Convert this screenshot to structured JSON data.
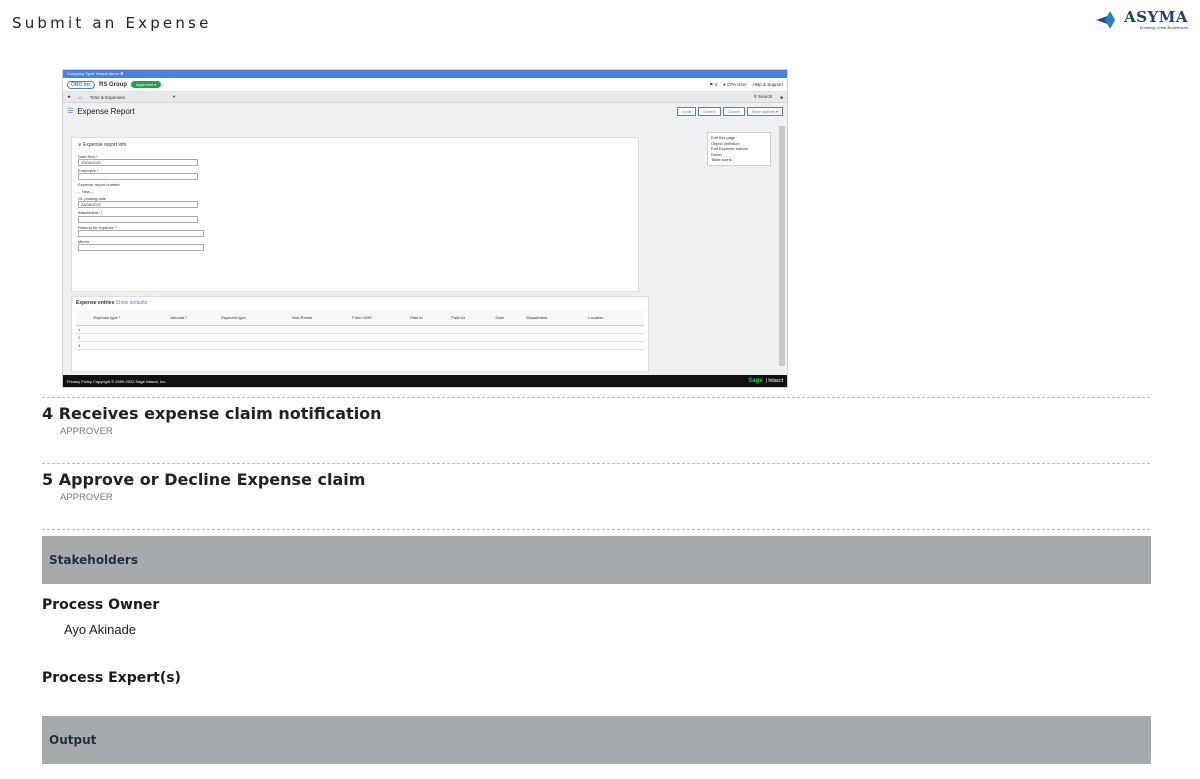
{
  "page": {
    "title": "Submit an Expense"
  },
  "logo": {
    "name": "ASYMA",
    "tagline": "Enabling Great Businesses"
  },
  "screenshot": {
    "topbar_text": "Company Type: Intacct demo ✖",
    "ribbon_logo": "OBO Inc",
    "company": "RS Group",
    "status": "Approved ▾",
    "user_area": {
      "flag": "⚑ 0",
      "user": "● CPA User",
      "help": "Help & Support"
    },
    "nav": {
      "home": "★",
      "house": "⌂",
      "module": "Time & Expenses",
      "caret": "▾",
      "search": "⚲ Search",
      "bookmark": "■"
    },
    "title": "Expense Report",
    "title_icon": "☰",
    "buttons": [
      "Draft",
      "Submit",
      "Cancel",
      "More actions ▾"
    ],
    "menu_items": [
      "Edit this page",
      "Object definition",
      "Edit Expense entries",
      "Reset",
      "Table size ▸"
    ],
    "section_title": "∨ Expense report info",
    "fields": [
      {
        "label": "Date filed *",
        "value": "10/06/2021"
      },
      {
        "label": "Employee *",
        "value": ""
      },
      {
        "label": "Expense report number",
        "value": "-- New --"
      },
      {
        "label": "GL posting date",
        "value": "28/06/2022"
      },
      {
        "label": "Attachment ⓘ",
        "value": ""
      },
      {
        "label": "Reason for expense *",
        "value": ""
      },
      {
        "label": "Memo",
        "value": ""
      }
    ],
    "entries_title": "Expense entries",
    "entries_link": "Show defaults",
    "columns": [
      "",
      "Expense type *",
      "Amount *",
      "Payment type",
      "Non-Reimb",
      "Form 1099",
      "Paid to",
      "Paid for",
      "Date",
      "Department",
      "Location",
      ""
    ],
    "rows": [
      "1",
      "2",
      "3"
    ],
    "footer_left": "Privacy Policy    Copyright © 1999-2022 Sage Intacct, Inc.",
    "footer_sage": "Sage",
    "footer_intacct": "| Intacct"
  },
  "steps": [
    {
      "number": "4",
      "title": "Receives expense claim notification",
      "role": "APPROVER"
    },
    {
      "number": "5",
      "title": "Approve or Decline Expense claim",
      "role": "APPROVER"
    }
  ],
  "stakeholders": {
    "heading": "Stakeholders",
    "owner_label": "Process Owner",
    "owner_value": "Ayo Akinade",
    "expert_label": "Process Expert(s)"
  },
  "output": {
    "heading": "Output"
  }
}
